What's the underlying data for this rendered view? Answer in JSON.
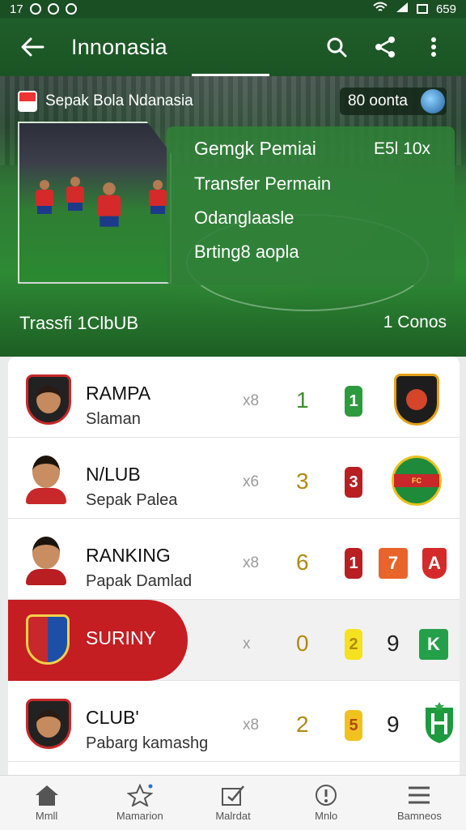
{
  "status_bar": {
    "left_text": "17",
    "time": "659"
  },
  "app_bar": {
    "title": "Innonasia",
    "back_icon": "arrow-left-icon",
    "search_icon": "search-icon",
    "share_icon": "share-icon",
    "more_icon": "more-vertical-icon"
  },
  "hero": {
    "league_name": "Sepak Bola Ndanasia",
    "score_pill": "80 oonta",
    "panel": {
      "header": "Gemgk Pemiai",
      "header_right": "E5l 10x",
      "items": [
        "Transfer Permain",
        "Odanglaasle",
        "Brting8 aopla"
      ]
    },
    "bottom_left": "Trassfi 1ClbUB",
    "bottom_right": "1 Conos"
  },
  "rows": [
    {
      "name": "RAMPA",
      "sub": "Slaman",
      "x": "x8",
      "num": "1",
      "num_color": "#3f8f2e",
      "badge": "1",
      "badge_color": "#2e9a3e"
    },
    {
      "name": "N/LUB",
      "sub": "Sepak Palea",
      "x": "x6",
      "num": "3",
      "num_color": "#b08a12",
      "badge": "3",
      "badge_color": "#b81e22"
    },
    {
      "name": "RANKING",
      "sub": "Papak Damlad",
      "x": "x8",
      "num": "6",
      "num_color": "#b08a12",
      "badge": "1",
      "badge_color": "#b81e22",
      "tag": "7",
      "tag_color": "#e8642a",
      "tag2": "A",
      "tag2_color": "#d42a2a"
    },
    {
      "name": "SURINY",
      "x": "x",
      "num": "0",
      "num_color": "#b08a12",
      "badge": "2",
      "badge_color": "#f5e21e",
      "num2": "9",
      "tag": "K",
      "tag_color": "#24a04a"
    },
    {
      "name": "CLUB'",
      "sub": "Pabarg kamashg",
      "x": "x8",
      "num": "2",
      "num_color": "#b08a12",
      "badge": "5",
      "badge_color": "#f0c21e",
      "num2": "9"
    }
  ],
  "bottom_nav": [
    {
      "label": "Mmll",
      "icon": "home-icon"
    },
    {
      "label": "Mamarion",
      "icon": "star-icon"
    },
    {
      "label": "Malrdat",
      "icon": "edit-check-icon"
    },
    {
      "label": "Mnlo",
      "icon": "info-icon"
    },
    {
      "label": "Bamneos",
      "icon": "menu-icon"
    }
  ]
}
